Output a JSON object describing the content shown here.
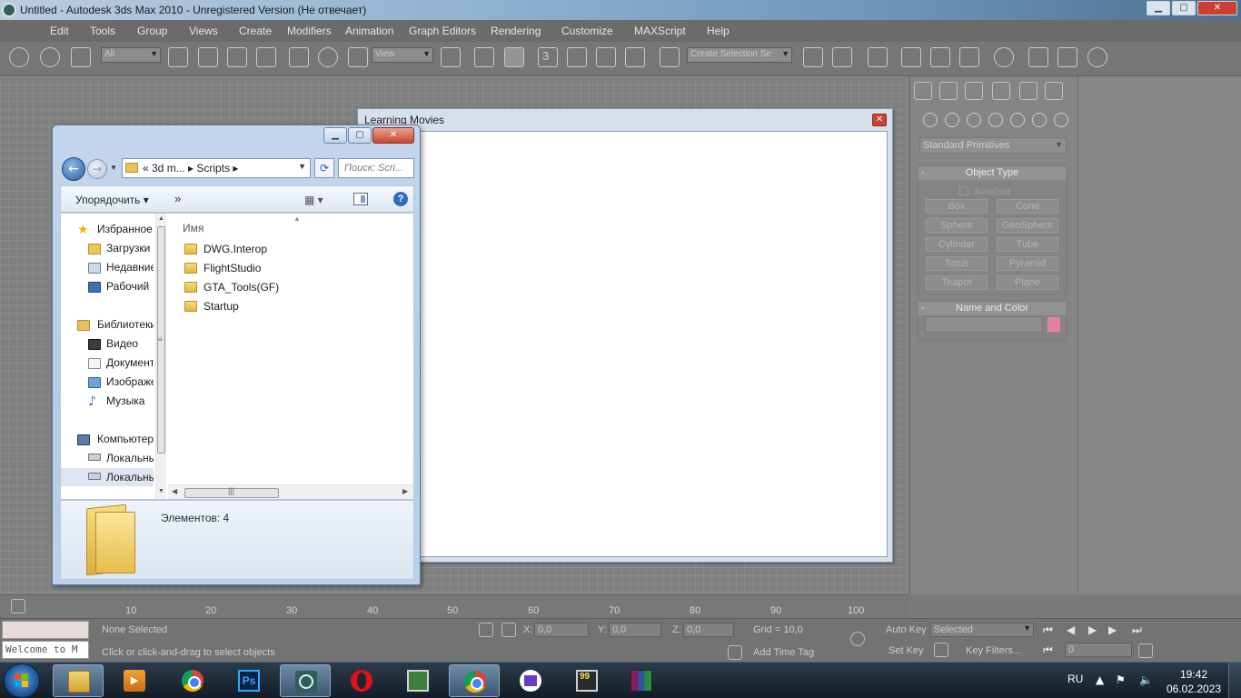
{
  "max_window": {
    "title": "Untitled - Autodesk 3ds Max  2010   - Unregistered Version (Не отвечает)",
    "controls": {
      "minimize": "▁",
      "maximize": "▢",
      "close": "✕"
    },
    "menu": [
      "Edit",
      "Tools",
      "Group",
      "Views",
      "Create",
      "Modifiers",
      "Animation",
      "Graph Editors",
      "Rendering",
      "Customize",
      "MAXScript",
      "Help"
    ],
    "toolbar": {
      "selection_filter": "All",
      "ref_coord": "View",
      "named_selection": "Create Selection Se",
      "snap_label": "3"
    }
  },
  "command_panel": {
    "category_dropdown": "Standard Primitives",
    "object_type": {
      "header": "Object Type",
      "autogrid_label": "AutoGrid",
      "buttons": [
        "Box",
        "Cone",
        "Sphere",
        "GeoSphere",
        "Cylinder",
        "Tube",
        "Torus",
        "Pyramid",
        "Teapot",
        "Plane"
      ]
    },
    "name_color": {
      "header": "Name and Color",
      "swatch_color": "#e77fa1"
    }
  },
  "timeline": {
    "ticks": [
      "10",
      "20",
      "30",
      "40",
      "50",
      "60",
      "70",
      "80",
      "90",
      "100"
    ]
  },
  "status": {
    "selection_state": "None Selected",
    "prompt": "Click or click-and-drag to select objects",
    "x_label": "X:",
    "x_value": "0,0",
    "y_label": "Y:",
    "y_value": "0,0",
    "z_label": "Z:",
    "z_value": "0,0",
    "grid": "Grid = 10,0",
    "add_time_tag": "Add Time Tag",
    "auto_key": "Auto Key",
    "set_key": "Set Key",
    "key_mode_selected": "Selected",
    "key_filters": "Key Filters...",
    "frame_value": "0",
    "maxscript_placeholder": "Welcome to M"
  },
  "learning_dialog": {
    "title": "Learning Movies",
    "close": "✕"
  },
  "explorer": {
    "controls": {
      "minimize": "▁",
      "maximize": "▢",
      "close": "✕"
    },
    "address": {
      "crumbs": "« 3d m...  ▸  Scripts  ▸"
    },
    "search_placeholder": "Поиск: Scri...",
    "toolbar": {
      "organize": "Упорядочить ▾",
      "more": "»",
      "views": "▦ ▾"
    },
    "nav": [
      {
        "label": "Избранное",
        "icon": "star-icon"
      },
      {
        "label": "Загрузки",
        "icon": "downloads-folder-icon"
      },
      {
        "label": "Недавние",
        "icon": "recent-places-icon"
      },
      {
        "label": "Рабочий",
        "icon": "desktop-icon"
      },
      {
        "label": "Библиотеки",
        "icon": "libraries-icon"
      },
      {
        "label": "Видео",
        "icon": "video-icon"
      },
      {
        "label": "Документы",
        "icon": "documents-icon"
      },
      {
        "label": "Изображения",
        "icon": "pictures-icon"
      },
      {
        "label": "Музыка",
        "icon": "music-icon"
      },
      {
        "label": "Компьютер",
        "icon": "computer-icon"
      },
      {
        "label": "Локальный",
        "icon": "local-disk-icon"
      },
      {
        "label": "Локальный",
        "icon": "local-disk-icon"
      }
    ],
    "column_name": "Имя",
    "files": [
      "DWG.Interop",
      "FlightStudio",
      "GTA_Tools(GF)",
      "Startup"
    ],
    "item_count": "Элементов: 4"
  },
  "taskbar": {
    "apps": [
      "start-button",
      "explorer",
      "media-player",
      "chrome",
      "photoshop",
      "3ds-max",
      "opera",
      "system-monitor",
      "chrome-profile",
      "home-app",
      "app-99",
      "winrar"
    ],
    "language": "RU",
    "time": "19:42",
    "date": "06.02.2023"
  }
}
